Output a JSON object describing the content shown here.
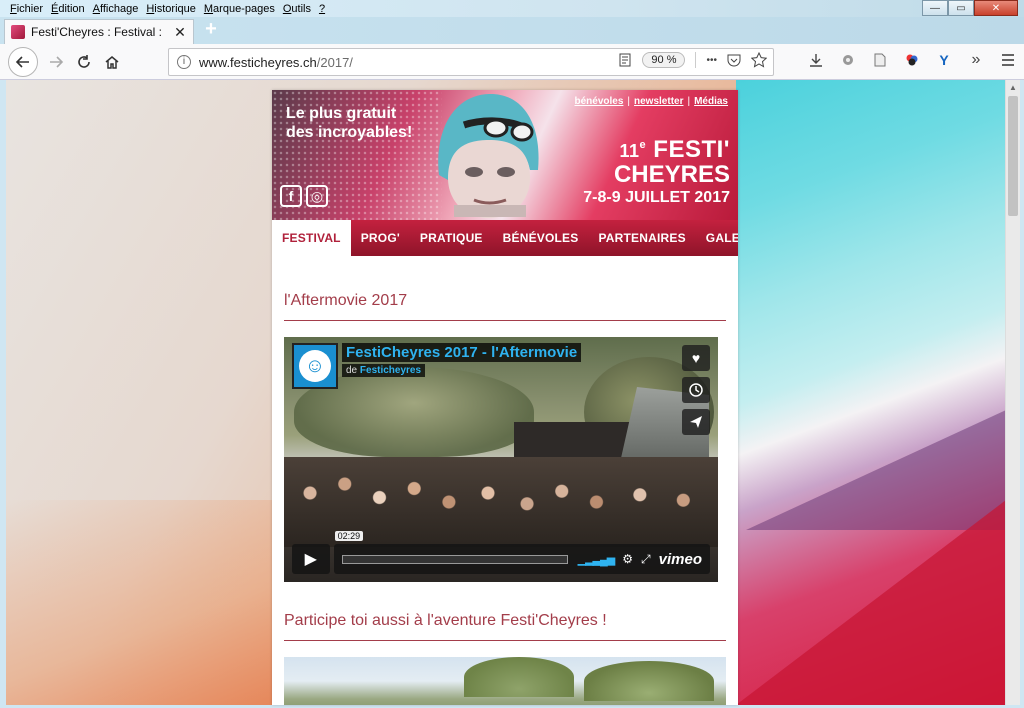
{
  "menubar": {
    "items": [
      {
        "key": "F",
        "rest": "ichier"
      },
      {
        "key": "É",
        "rest": "dition"
      },
      {
        "key": "A",
        "rest": "ffichage"
      },
      {
        "key": "H",
        "rest": "istorique"
      },
      {
        "key": "M",
        "rest": "arque-pages"
      },
      {
        "key": "O",
        "rest": "utils"
      },
      {
        "key": "?",
        "rest": ""
      }
    ]
  },
  "window": {
    "minimize": "—",
    "maximize": "▭",
    "close": "✕"
  },
  "tab": {
    "title": "Festi'Cheyres : Festival :",
    "close": "✕",
    "new_tab": "+"
  },
  "navbar": {
    "url_host": "www.festicheyres.ch",
    "url_path": "/2017/",
    "zoom": "90 %",
    "more": "•••"
  },
  "banner": {
    "tagline_line1": "Le plus gratuit",
    "tagline_line2": "des incroyables!",
    "links": [
      "bénévoles",
      "newsletter",
      "Médias"
    ],
    "separator": "|",
    "edition_num": "11",
    "edition_sup": "e",
    "edition_word1": "FESTI'",
    "edition_word2": "CHEYRES",
    "dates": "7-8-9 JUILLET 2017",
    "facebook": "f",
    "instagram": "◎"
  },
  "mainnav": {
    "items": [
      "FESTIVAL",
      "PROG'",
      "PRATIQUE",
      "BÉNÉVOLES",
      "PARTENAIRES",
      "GALERIES"
    ]
  },
  "sections": {
    "aftermovie_title": "l'Aftermovie 2017",
    "aventure_title": "Participe toi aussi à l'aventure Festi'Cheyres !"
  },
  "video": {
    "title": "FestiCheyres 2017 - l'Aftermovie",
    "by_prefix": "de",
    "by_name": "Festicheyres",
    "timecode": "02:29",
    "brand": "vimeo",
    "progress": 0
  }
}
